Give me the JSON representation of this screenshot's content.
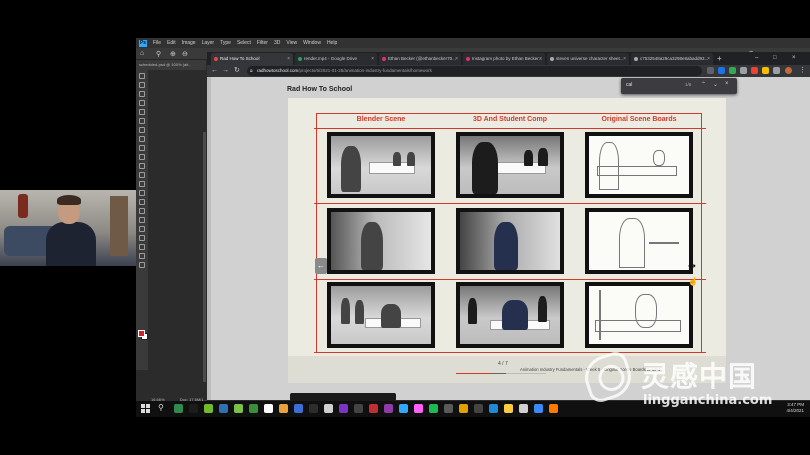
{
  "photoshop": {
    "logo": "Ps",
    "menu": [
      "File",
      "Edit",
      "Image",
      "Layer",
      "Type",
      "Select",
      "Filter",
      "3D",
      "View",
      "Window",
      "Help"
    ],
    "doc_tab": "scheduled-psd @ 100% (alt...",
    "status_zoom": "16.66%",
    "status_doc": "Doc: 17.6M/1..."
  },
  "browser": {
    "tabs": [
      {
        "title": "Rad How To School",
        "color": "#e8453c"
      },
      {
        "title": "render.mp4 - Google Drive",
        "color": "#1fa463"
      },
      {
        "title": "Ethan Becker (@ethanbecker70...",
        "color": "#e1306c"
      },
      {
        "title": "Instagram photo by Ethan Becker...",
        "color": "#e1306c"
      },
      {
        "title": "steven universe character sheet...",
        "color": "#aaaaaa"
      },
      {
        "title": "c7532548a29ca3298e8abadd93...",
        "color": "#aaaaaa"
      }
    ],
    "url_host": "radhowtoschool.com",
    "url_path": "/projects/6/2021-01-25/animation-industry-fundamentals/homework",
    "find": {
      "query": "cal",
      "count": "1/6"
    }
  },
  "slide": {
    "site_title": "Rad How To School",
    "columns": [
      "Blender Scene",
      "3D And Student Comp",
      "Original Scene Boards"
    ],
    "page_number": "4 / 7",
    "caption": "Animation Industry Fundamentals - Week 5 - Original Scene Boards to MP4",
    "progress_percent": 40
  },
  "taskbar": {
    "time": "3:47 PM",
    "date": "4/4/2021",
    "apps": [
      "#2f8a4c",
      "#1d1d1d",
      "#71ba2b",
      "#2f6fb3",
      "#7ac04a",
      "#3c8f3a",
      "#ffffff",
      "#e8a33c",
      "#3b6ed6",
      "#2d2d2d",
      "#d0d0d0",
      "#7a35c8",
      "#444444",
      "#c03030",
      "#8e3aa8",
      "#31a8ff",
      "#ff61f6",
      "#1db954",
      "#5a5a5a",
      "#e2a100",
      "#444444",
      "#1f8ad6",
      "#f9cb41",
      "#d0d0d0",
      "#3b88ff",
      "#ff7a00"
    ]
  },
  "watermark": {
    "cn": "灵感中国",
    "en": "lingganchina.com"
  }
}
